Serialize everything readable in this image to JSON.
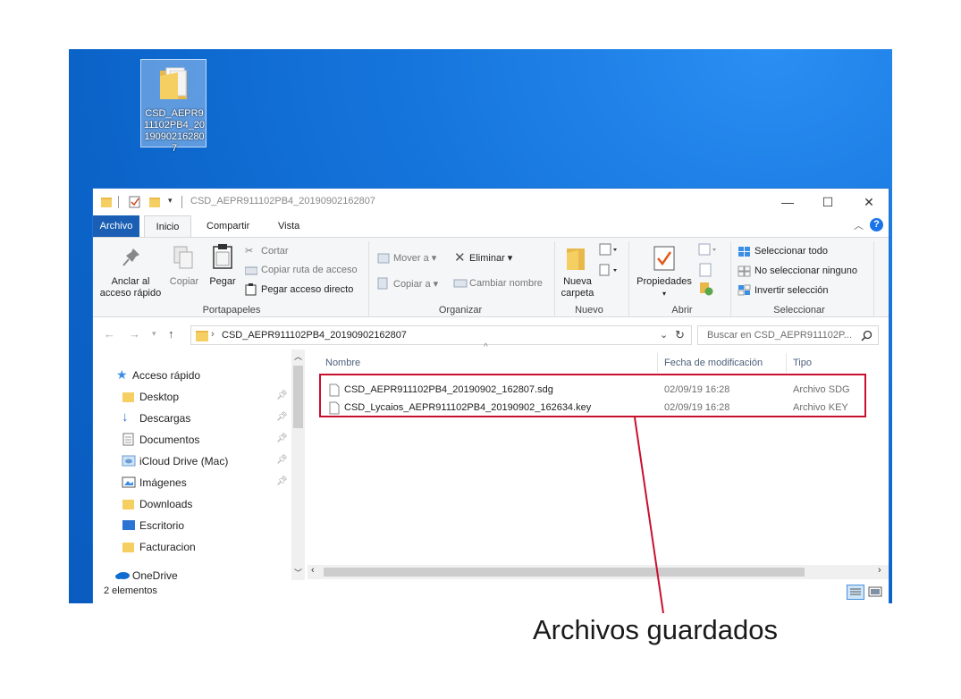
{
  "desktop": {
    "icon_label": "CSD_AEPR911102PB4_20190902162807"
  },
  "window": {
    "title": "CSD_AEPR911102PB4_20190902162807",
    "controls": {
      "minimize": "—",
      "maximize": "☐",
      "close": "✕"
    }
  },
  "tabs": [
    "Archivo",
    "Inicio",
    "Compartir",
    "Vista"
  ],
  "ribbon": {
    "clipboard": {
      "pin_line1": "Anclar al",
      "pin_line2": "acceso rápido",
      "copy": "Copiar",
      "paste": "Pegar",
      "cut": "Cortar",
      "copy_path": "Copiar ruta de acceso",
      "paste_shortcut": "Pegar acceso directo",
      "label": "Portapapeles"
    },
    "organize": {
      "move_to": "Mover a",
      "copy_to": "Copiar a",
      "delete": "Eliminar",
      "rename": "Cambiar nombre",
      "label": "Organizar"
    },
    "new": {
      "folder_line1": "Nueva",
      "folder_line2": "carpeta",
      "label": "Nuevo"
    },
    "open": {
      "properties": "Propiedades",
      "label": "Abrir"
    },
    "select": {
      "select_all": "Seleccionar todo",
      "select_none": "No seleccionar ninguno",
      "invert": "Invertir selección",
      "label": "Seleccionar"
    }
  },
  "address": {
    "path": "CSD_AEPR911102PB4_20190902162807",
    "search_placeholder": "Buscar en CSD_AEPR911102P..."
  },
  "nav": {
    "quick_access": "Acceso rápido",
    "items": [
      "Desktop",
      "Descargas",
      "Documentos",
      "iCloud Drive (Mac)",
      "Imágenes",
      "Downloads",
      "Escritorio",
      "Facturacion"
    ],
    "onedrive": "OneDrive"
  },
  "columns": {
    "name": "Nombre",
    "date": "Fecha de modificación",
    "type": "Tipo"
  },
  "files": [
    {
      "name": "CSD_AEPR911102PB4_20190902_162807.sdg",
      "date": "02/09/19 16:28",
      "type": "Archivo SDG"
    },
    {
      "name": "CSD_Lycaios_AEPR911102PB4_20190902_162634.key",
      "date": "02/09/19 16:28",
      "type": "Archivo KEY"
    }
  ],
  "status": {
    "count": "2 elementos"
  },
  "annotation": {
    "caption": "Archivos guardados",
    "color": "#c8102e"
  }
}
